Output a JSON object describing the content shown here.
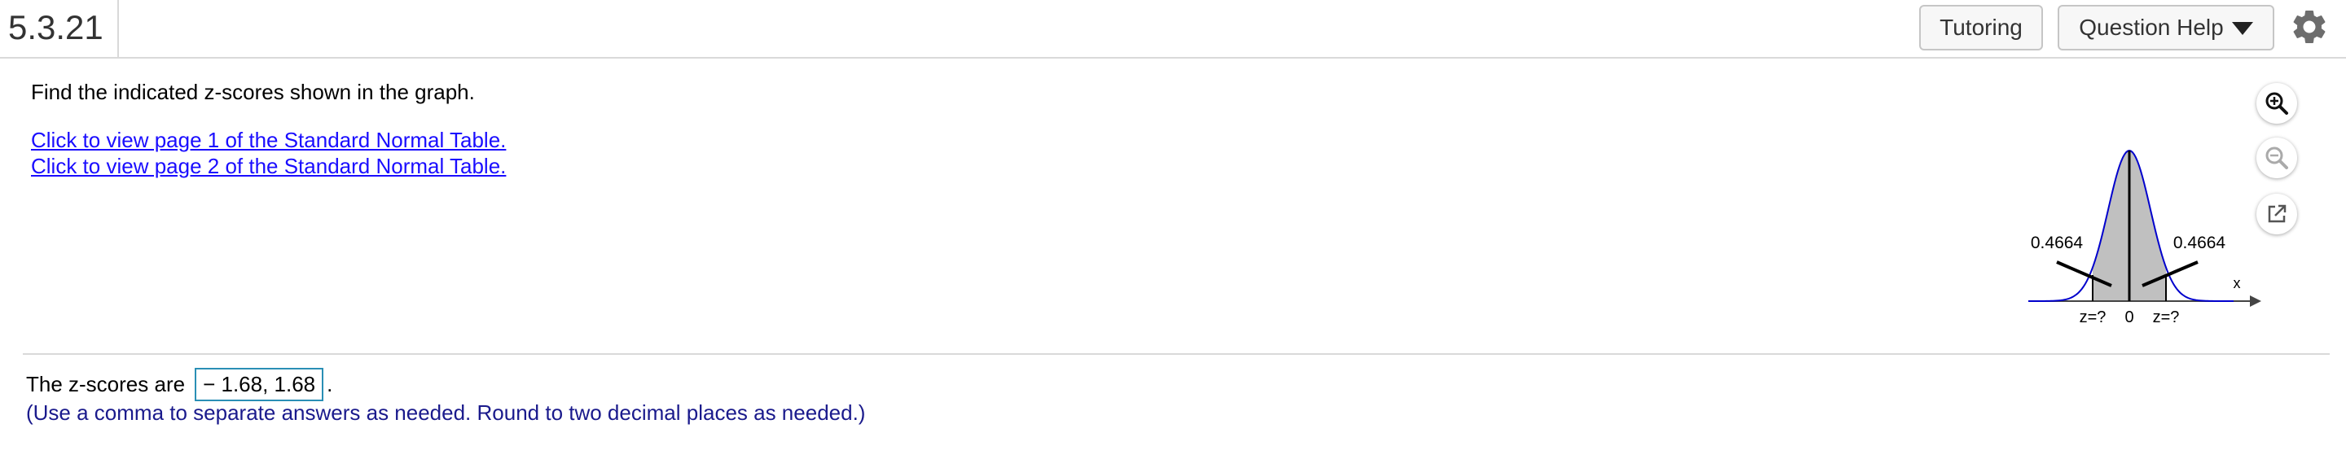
{
  "header": {
    "question_number": "5.3.21",
    "tutoring_label": "Tutoring",
    "question_help_label": "Question Help",
    "settings_icon": "gear-icon"
  },
  "question": {
    "instruction": "Find the indicated z-scores shown in the graph.",
    "links": [
      "Click to view page 1 of the Standard Normal Table.",
      "Click to view page 2 of the Standard Normal Table."
    ]
  },
  "graph": {
    "left_area_label": "0.4664",
    "right_area_label": "0.4664",
    "x_axis_label": "x",
    "left_z_label": "z=?",
    "center_label": "0",
    "right_z_label": "z=?",
    "curve_color": "#0000cc",
    "shade_color": "#c0c0c0"
  },
  "tools": [
    "zoom-in-icon",
    "zoom-out-icon",
    "popout-icon"
  ],
  "answer": {
    "prefix": "The z-scores are",
    "value": "− 1.68, 1.68",
    "suffix": ".",
    "note": "(Use a comma to separate answers as needed. Round to two decimal places as needed.)"
  }
}
